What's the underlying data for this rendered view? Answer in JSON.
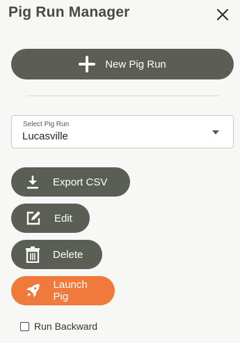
{
  "header": {
    "title": "Pig Run Manager",
    "close_icon": "close-icon"
  },
  "actions": {
    "new_pig_run_label": "New Pig Run"
  },
  "select": {
    "label": "Select Pig Run",
    "value": "Lucasville"
  },
  "buttons": {
    "export_label": "Export CSV",
    "edit_label": "Edit",
    "delete_label": "Delete",
    "launch_label": "Launch Pig"
  },
  "options": {
    "run_backward_label": "Run Backward",
    "run_backward_checked": false
  },
  "colors": {
    "primary": "#5a5e55",
    "accent": "#f07a3c",
    "title": "#474a44"
  }
}
